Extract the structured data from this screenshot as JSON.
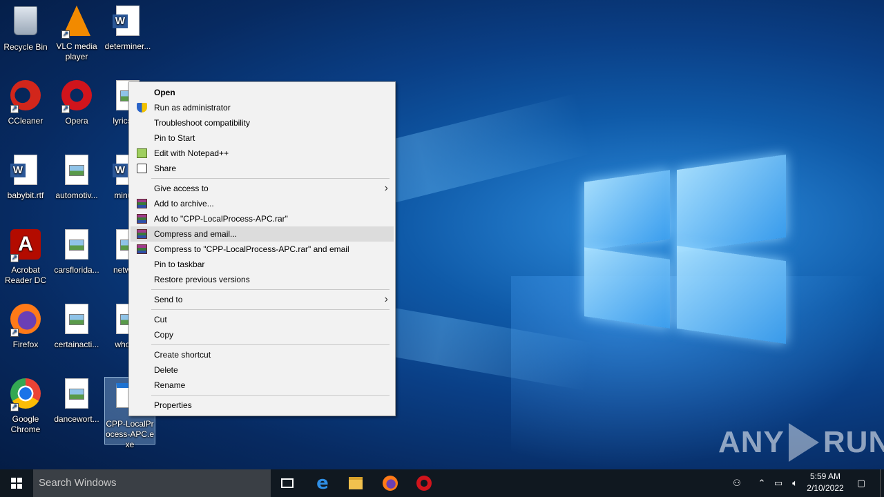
{
  "desktop": {
    "icons": [
      {
        "label": "Recycle Bin"
      },
      {
        "label": "VLC media player"
      },
      {
        "label": "determiner..."
      },
      {
        "label": "CCleaner"
      },
      {
        "label": "Opera"
      },
      {
        "label": "lyricss..."
      },
      {
        "label": "babybit.rtf"
      },
      {
        "label": "automotiv..."
      },
      {
        "label": "minut..."
      },
      {
        "label": "Acrobat Reader DC"
      },
      {
        "label": "carsflorida..."
      },
      {
        "label": "netwo..."
      },
      {
        "label": "Firefox"
      },
      {
        "label": "certainacti..."
      },
      {
        "label": "wholi..."
      },
      {
        "label": "Google Chrome"
      },
      {
        "label": "dancewort..."
      },
      {
        "label": "CPP-LocalProcess-APC.exe"
      }
    ]
  },
  "context_menu": {
    "open": "Open",
    "run_as_admin": "Run as administrator",
    "troubleshoot": "Troubleshoot compatibility",
    "pin_to_start": "Pin to Start",
    "edit_notepad": "Edit with Notepad++",
    "share": "Share",
    "give_access": "Give access to",
    "add_to_archive": "Add to archive...",
    "add_to_rar": "Add to \"CPP-LocalProcess-APC.rar\"",
    "compress_email": "Compress and email...",
    "compress_rar_email": "Compress to \"CPP-LocalProcess-APC.rar\" and email",
    "pin_taskbar": "Pin to taskbar",
    "restore_versions": "Restore previous versions",
    "send_to": "Send to",
    "cut": "Cut",
    "copy": "Copy",
    "create_shortcut": "Create shortcut",
    "delete": "Delete",
    "rename": "Rename",
    "properties": "Properties"
  },
  "taskbar": {
    "search_placeholder": "Search Windows",
    "time": "5:59 AM",
    "date": "2/10/2022"
  },
  "watermark": {
    "left": "ANY",
    "right": "RUN"
  }
}
